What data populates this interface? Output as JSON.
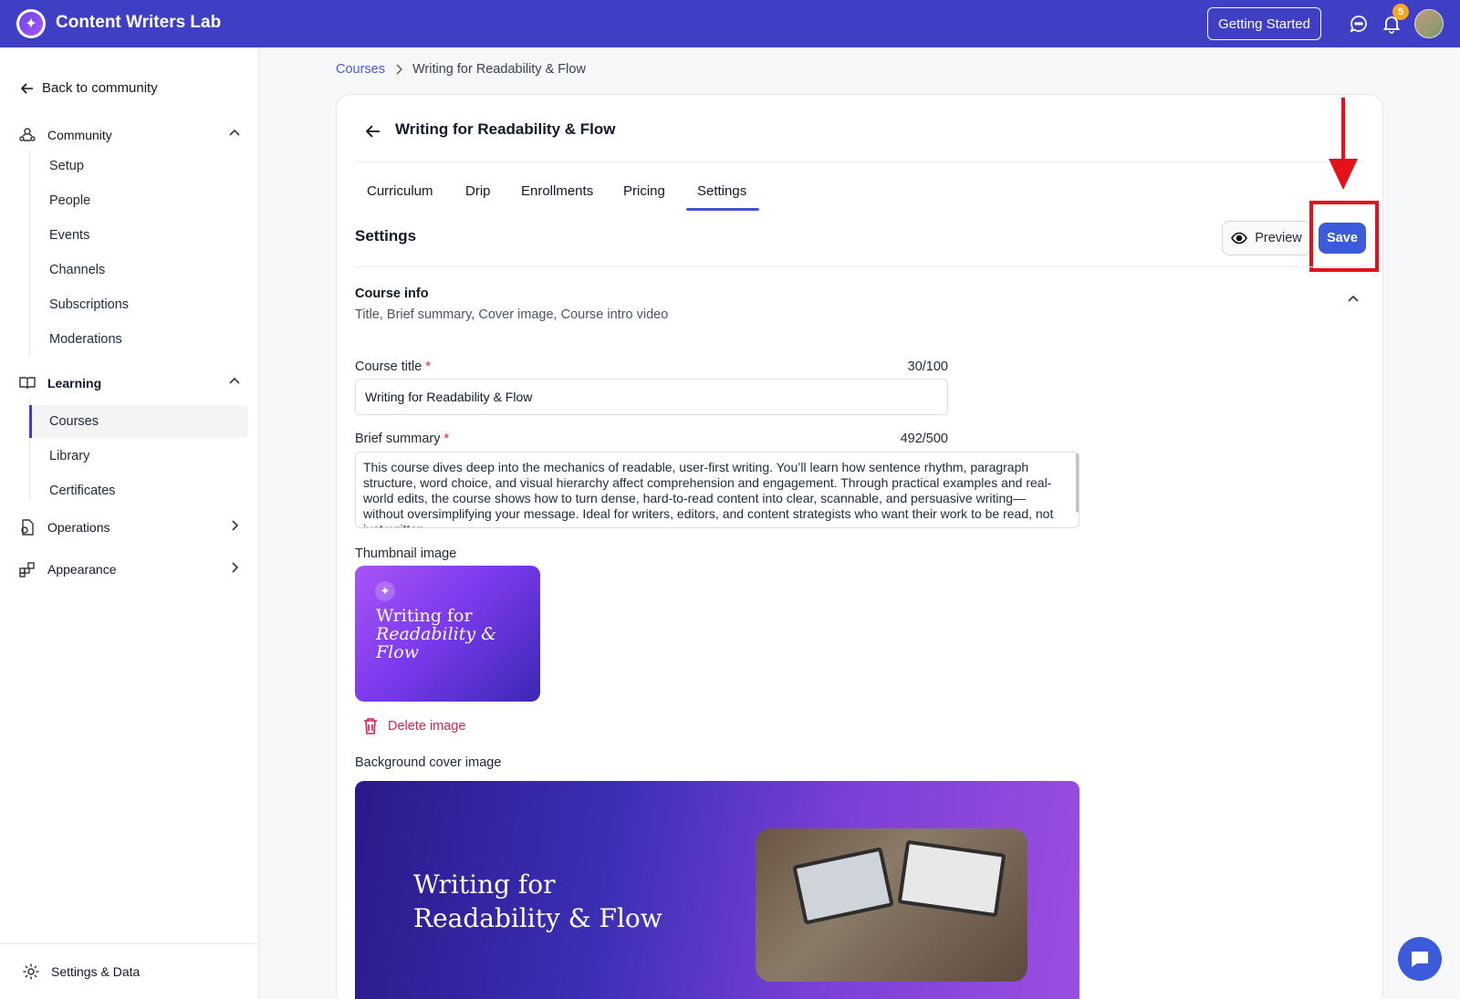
{
  "app": {
    "brand": "Content Writers Lab",
    "getting_started": "Getting Started",
    "notification_count": "5",
    "accent_color": "#3f3fc5"
  },
  "sidebar": {
    "back": "Back to community",
    "community": {
      "label": "Community",
      "items": [
        "Setup",
        "People",
        "Events",
        "Channels",
        "Subscriptions",
        "Moderations"
      ]
    },
    "learning": {
      "label": "Learning",
      "items": [
        "Courses",
        "Library",
        "Certificates"
      ],
      "active": "Courses"
    },
    "operations": "Operations",
    "appearance": "Appearance",
    "footer": "Settings & Data"
  },
  "breadcrumb": {
    "root": "Courses",
    "current": "Writing for Readability & Flow"
  },
  "course": {
    "title": "Writing for Readability & Flow",
    "tabs": [
      "Curriculum",
      "Drip",
      "Enrollments",
      "Pricing",
      "Settings"
    ],
    "active_tab": "Settings"
  },
  "settings": {
    "heading": "Settings",
    "preview_label": "Preview",
    "save_label": "Save",
    "course_info": {
      "title": "Course info",
      "subtitle": "Title, Brief summary, Cover image, Course intro video"
    },
    "course_title": {
      "label": "Course title",
      "required_mark": "*",
      "count": "30/100",
      "value": "Writing for Readability & Flow"
    },
    "brief_summary": {
      "label": "Brief summary",
      "required_mark": "*",
      "count": "492/500",
      "value": "This course dives deep into the mechanics of readable, user-first writing. You’ll learn how sentence rhythm, paragraph structure, word choice, and visual hierarchy affect comprehension and engagement. Through practical examples and real-world edits, the course shows how to turn dense, hard-to-read content into clear, scannable, and persuasive writing—without oversimplifying your message. Ideal for writers, editors, and content strategists who want their work to be read, not just written."
    },
    "thumbnail": {
      "label": "Thumbnail image",
      "text_line1": "Writing for",
      "text_line2": "Readability &",
      "text_line3": "Flow",
      "delete_label": "Delete image"
    },
    "cover": {
      "label": "Background cover image",
      "text_line1": "Writing for",
      "text_line2": "Readability & Flow"
    }
  }
}
